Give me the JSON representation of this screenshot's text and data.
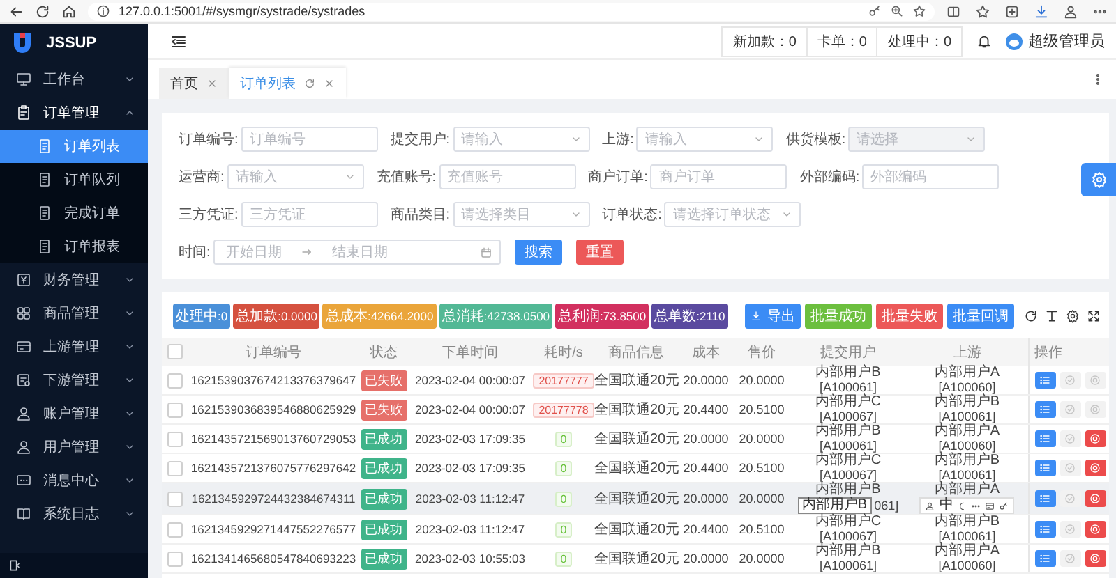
{
  "browser": {
    "url": "127.0.0.1:5001/#/sysmgr/systrade/systrades"
  },
  "logo": {
    "text": "JSSUP"
  },
  "sidebar": {
    "items": [
      {
        "label": "工作台",
        "expanded": false
      },
      {
        "label": "订单管理",
        "expanded": true,
        "children": [
          {
            "label": "订单列表",
            "selected": true
          },
          {
            "label": "订单队列",
            "selected": false
          },
          {
            "label": "完成订单",
            "selected": false
          },
          {
            "label": "订单报表",
            "selected": false
          }
        ]
      },
      {
        "label": "财务管理",
        "expanded": false
      },
      {
        "label": "商品管理",
        "expanded": false
      },
      {
        "label": "上游管理",
        "expanded": false
      },
      {
        "label": "下游管理",
        "expanded": false
      },
      {
        "label": "账户管理",
        "expanded": false
      },
      {
        "label": "用户管理",
        "expanded": false
      },
      {
        "label": "消息中心",
        "expanded": false
      },
      {
        "label": "系统日志",
        "expanded": false
      }
    ]
  },
  "header": {
    "stats": [
      "新加款：0",
      "卡单：0",
      "处理中：0"
    ],
    "user": "超级管理员"
  },
  "tabs": [
    {
      "label": "首页",
      "selected": false,
      "refreshable": false
    },
    {
      "label": "订单列表",
      "selected": true,
      "refreshable": true
    }
  ],
  "form": {
    "rows": [
      [
        {
          "label": "订单编号:",
          "kind": "input",
          "placeholder": "订单编号",
          "disabled": false
        },
        {
          "label": "提交用户:",
          "kind": "select",
          "placeholder": "请输入",
          "disabled": false
        },
        {
          "label": "上游:",
          "kind": "select",
          "placeholder": "请输入",
          "disabled": false
        },
        {
          "label": "供货模板:",
          "kind": "select",
          "placeholder": "请选择",
          "disabled": true
        }
      ],
      [
        {
          "label": "运营商:",
          "kind": "select",
          "placeholder": "请输入",
          "disabled": false
        },
        {
          "label": "充值账号:",
          "kind": "input",
          "placeholder": "充值账号",
          "disabled": false
        },
        {
          "label": "商户订单:",
          "kind": "input",
          "placeholder": "商户订单",
          "disabled": false
        },
        {
          "label": "外部编码:",
          "kind": "input",
          "placeholder": "外部编码",
          "disabled": false
        }
      ],
      [
        {
          "label": "三方凭证:",
          "kind": "input",
          "placeholder": "三方凭证",
          "disabled": false
        },
        {
          "label": "商品类目:",
          "kind": "select",
          "placeholder": "请选择类目",
          "disabled": false
        },
        {
          "label": "订单状态:",
          "kind": "select",
          "placeholder": "请选择订单状态",
          "disabled": false
        }
      ],
      [
        {
          "label": "时间:",
          "kind": "daterange",
          "start_placeholder": "开始日期",
          "end_placeholder": "结束日期",
          "disabled": false
        }
      ]
    ],
    "actions": [
      {
        "label": "搜索",
        "kind": "primary"
      },
      {
        "label": "重置",
        "kind": "danger"
      }
    ]
  },
  "table": {
    "summary": [
      {
        "text": "处理中:0",
        "color": "#4a90d9"
      },
      {
        "text": "总加款:0.0000",
        "color": "#d5513f"
      },
      {
        "text": "总成本:42664.2000",
        "color": "#eaa53a"
      },
      {
        "text": "总消耗:42738.0500",
        "color": "#52b895"
      },
      {
        "text": "总利润:73.8500",
        "color": "#d2305f"
      },
      {
        "text": "总单数:2110",
        "color": "#5a4a9f"
      }
    ],
    "actions": [
      {
        "label": "导出",
        "kind": "export"
      },
      {
        "label": "批量成功",
        "kind": "success"
      },
      {
        "label": "批量失败",
        "kind": "fail"
      },
      {
        "label": "批量回调",
        "kind": "callback"
      }
    ],
    "columns": [
      "订单编号",
      "状态",
      "下单时间",
      "耗时/s",
      "商品信息",
      "成本",
      "售价",
      "提交用户",
      "上游",
      "操作"
    ],
    "header_checked": false,
    "rows": [
      {
        "checked": false,
        "hovered": false,
        "order_no": "1621539037674213376379647",
        "status": {
          "text": "已失败",
          "kind": "failed"
        },
        "time": "2023-02-04 00:00:07",
        "duration": "20177777",
        "product": "全国联通20元",
        "cost": "20.0000",
        "price": "20.0000",
        "user": [
          "内部用户B",
          "[A100061]"
        ],
        "upstream": [
          "内部用户A",
          "[A100060]"
        ],
        "cancel_disabled": true
      },
      {
        "checked": false,
        "hovered": false,
        "order_no": "1621539036839546880625929",
        "status": {
          "text": "已失败",
          "kind": "failed"
        },
        "time": "2023-02-04 00:00:07",
        "duration": "20177778",
        "product": "全国联通20元",
        "cost": "20.4400",
        "price": "20.5100",
        "user": [
          "内部用户C",
          "[A100067]"
        ],
        "upstream": [
          "内部用户B",
          "[A100061]"
        ],
        "cancel_disabled": true
      },
      {
        "checked": false,
        "hovered": false,
        "order_no": "1621435721569013760729053",
        "status": {
          "text": "已成功",
          "kind": "success"
        },
        "time": "2023-02-03 17:09:35",
        "duration": "0",
        "product": "全国联通20元",
        "cost": "20.0000",
        "price": "20.0000",
        "user": [
          "内部用户B",
          "[A100061]"
        ],
        "upstream": [
          "内部用户A",
          "[A100060]"
        ],
        "cancel_disabled": false
      },
      {
        "checked": false,
        "hovered": false,
        "order_no": "1621435721376075776297642",
        "status": {
          "text": "已成功",
          "kind": "success"
        },
        "time": "2023-02-03 17:09:35",
        "duration": "0",
        "product": "全国联通20元",
        "cost": "20.4400",
        "price": "20.5100",
        "user": [
          "内部用户C",
          "[A100067]"
        ],
        "upstream": [
          "内部用户B",
          "[A100061]"
        ],
        "cancel_disabled": false
      },
      {
        "checked": false,
        "hovered": true,
        "order_no": "1621345929724432384674311",
        "status": {
          "text": "已成功",
          "kind": "success"
        },
        "time": "2023-02-03 11:12:47",
        "duration": "0",
        "product": "全国联通20元",
        "cost": "20.0000",
        "price": "20.0000",
        "user": [
          "内部用户B",
          "061]"
        ],
        "tooltip": "内部用户B",
        "upstream": [
          "内部用户A"
        ],
        "ime_label": "中",
        "cancel_disabled": false
      },
      {
        "checked": false,
        "hovered": false,
        "order_no": "1621345929271447552276577",
        "status": {
          "text": "已成功",
          "kind": "success"
        },
        "time": "2023-02-03 11:12:47",
        "duration": "0",
        "product": "全国联通20元",
        "cost": "20.4400",
        "price": "20.5100",
        "user": [
          "内部用户C",
          "[A100067]"
        ],
        "upstream": [
          "内部用户B",
          "[A100061]"
        ],
        "cancel_disabled": false
      },
      {
        "checked": false,
        "hovered": false,
        "order_no": "1621341465680547840693223",
        "status": {
          "text": "已成功",
          "kind": "success"
        },
        "time": "2023-02-03 10:55:03",
        "duration": "0",
        "product": "全国联通20元",
        "cost": "20.0000",
        "price": "20.0000",
        "user": [
          "内部用户B",
          "[A100061]"
        ],
        "upstream": [
          "内部用户A",
          "[A100060]"
        ],
        "cancel_disabled": false
      }
    ]
  }
}
